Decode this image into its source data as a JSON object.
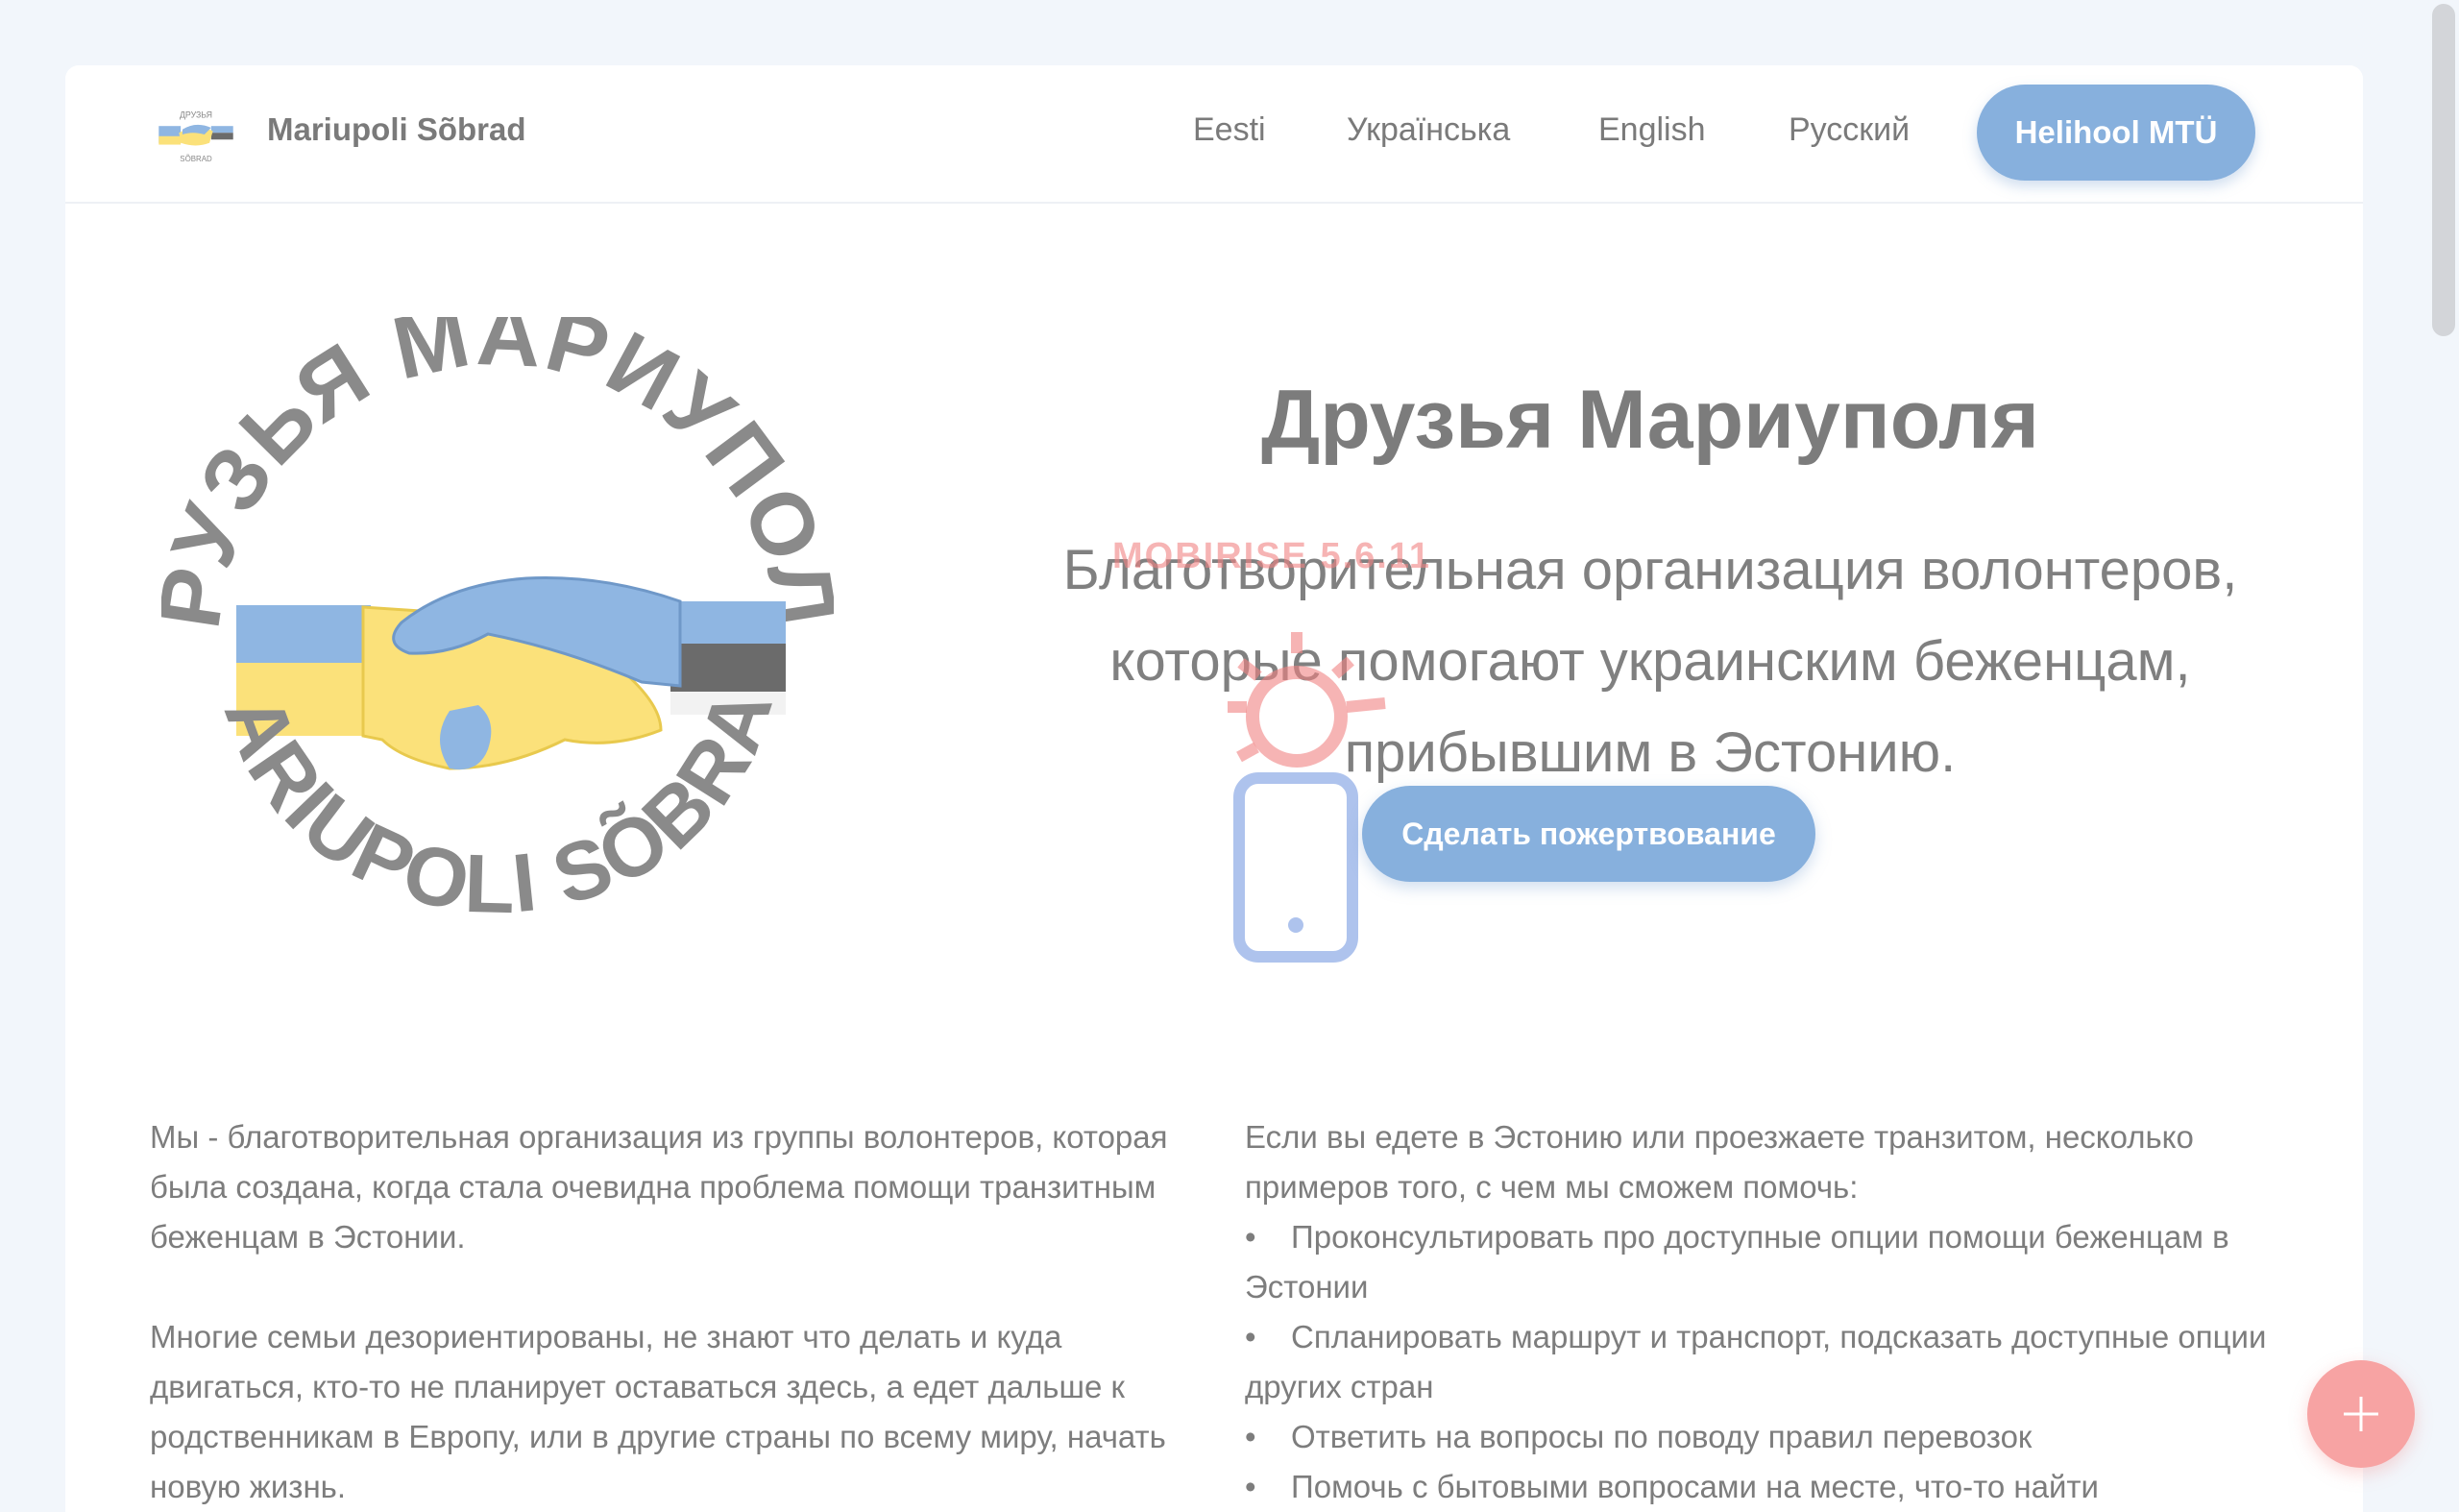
{
  "brand": {
    "name": "Mariupoli Sõbrad"
  },
  "nav": {
    "links": [
      "Eesti",
      "Українська",
      "English",
      "Русский"
    ],
    "button_label": "Helihool MTÜ"
  },
  "hero": {
    "title": "Друзья Мариуполя",
    "subtitle": "Благотворительная организация волонтеров, которые помогают украинским беженцам, прибывшим в Эстонию.",
    "logo_top_text": "ДРУЗЬЯ МАРИУПОЛЯ",
    "logo_bottom_text": "MARIUPOLI SÕBRAD",
    "cta_label": "Сделать пожертвование"
  },
  "watermark": {
    "text": "MOBIRISE 5.6.11"
  },
  "content": {
    "left": [
      "Мы - благотворительная организация из группы волонтеров, которая была создана, когда стала очевидна проблема помощи транзитным беженцам в Эстонии.",
      "Многие семьи дезориентированы, не знают что делать и куда двигаться, кто-то не планирует оставаться здесь, а едет дальше к родственникам в Европу, или в другие страны по всему миру, начать новую жизнь."
    ],
    "right_intro": "Если вы едете в Эстонию или проезжаете транзитом, несколько примеров того, с чем мы сможем помочь:",
    "right_items": [
      "Проконсультировать про доступные опции помощи беженцам в Эстонии",
      "Спланировать маршрут и транспорт, подсказать доступные опции других стран",
      "Ответить на вопросы по поводу правил перевозок",
      "Помочь с бытовыми вопросами на месте, что-то найти"
    ]
  },
  "colors": {
    "accent_blue": "#87b0dd",
    "fab_pink": "#f7a3a3",
    "ukraine_yellow": "#fbe17a",
    "estonia_black": "#6b6b6b"
  }
}
